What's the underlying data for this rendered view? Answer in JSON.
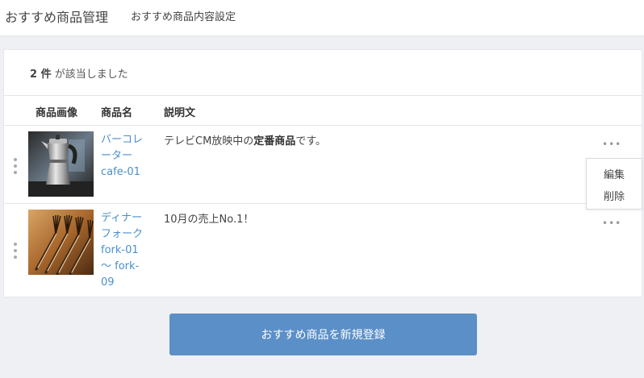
{
  "header": {
    "title": "おすすめ商品管理",
    "subtitle": "おすすめ商品内容設定"
  },
  "result": {
    "count": "2 件",
    "suffix": "が該当しました"
  },
  "table": {
    "columns": [
      "商品画像",
      "商品名",
      "説明文"
    ],
    "rows": [
      {
        "name_lines": [
          "バーコレ",
          "ーター",
          "cafe-01"
        ],
        "desc_before": "テレビCM放映中の",
        "desc_bold": "定番商品",
        "desc_after": "です。",
        "image": "coffee-maker-photo",
        "more": "•••"
      },
      {
        "name_lines": [
          "ディナー",
          "フォーク",
          "fork-01",
          "〜 fork-",
          "09"
        ],
        "desc": "10月の売上No.1！",
        "image": "forks-photo",
        "more": "•••"
      }
    ]
  },
  "row_menu": {
    "edit": "編集",
    "delete": "削除"
  },
  "register_button": "おすすめ商品を新規登録",
  "colors": {
    "accent": "#5b8fc7",
    "link": "#4a8fcb",
    "background": "#eef0f3"
  }
}
